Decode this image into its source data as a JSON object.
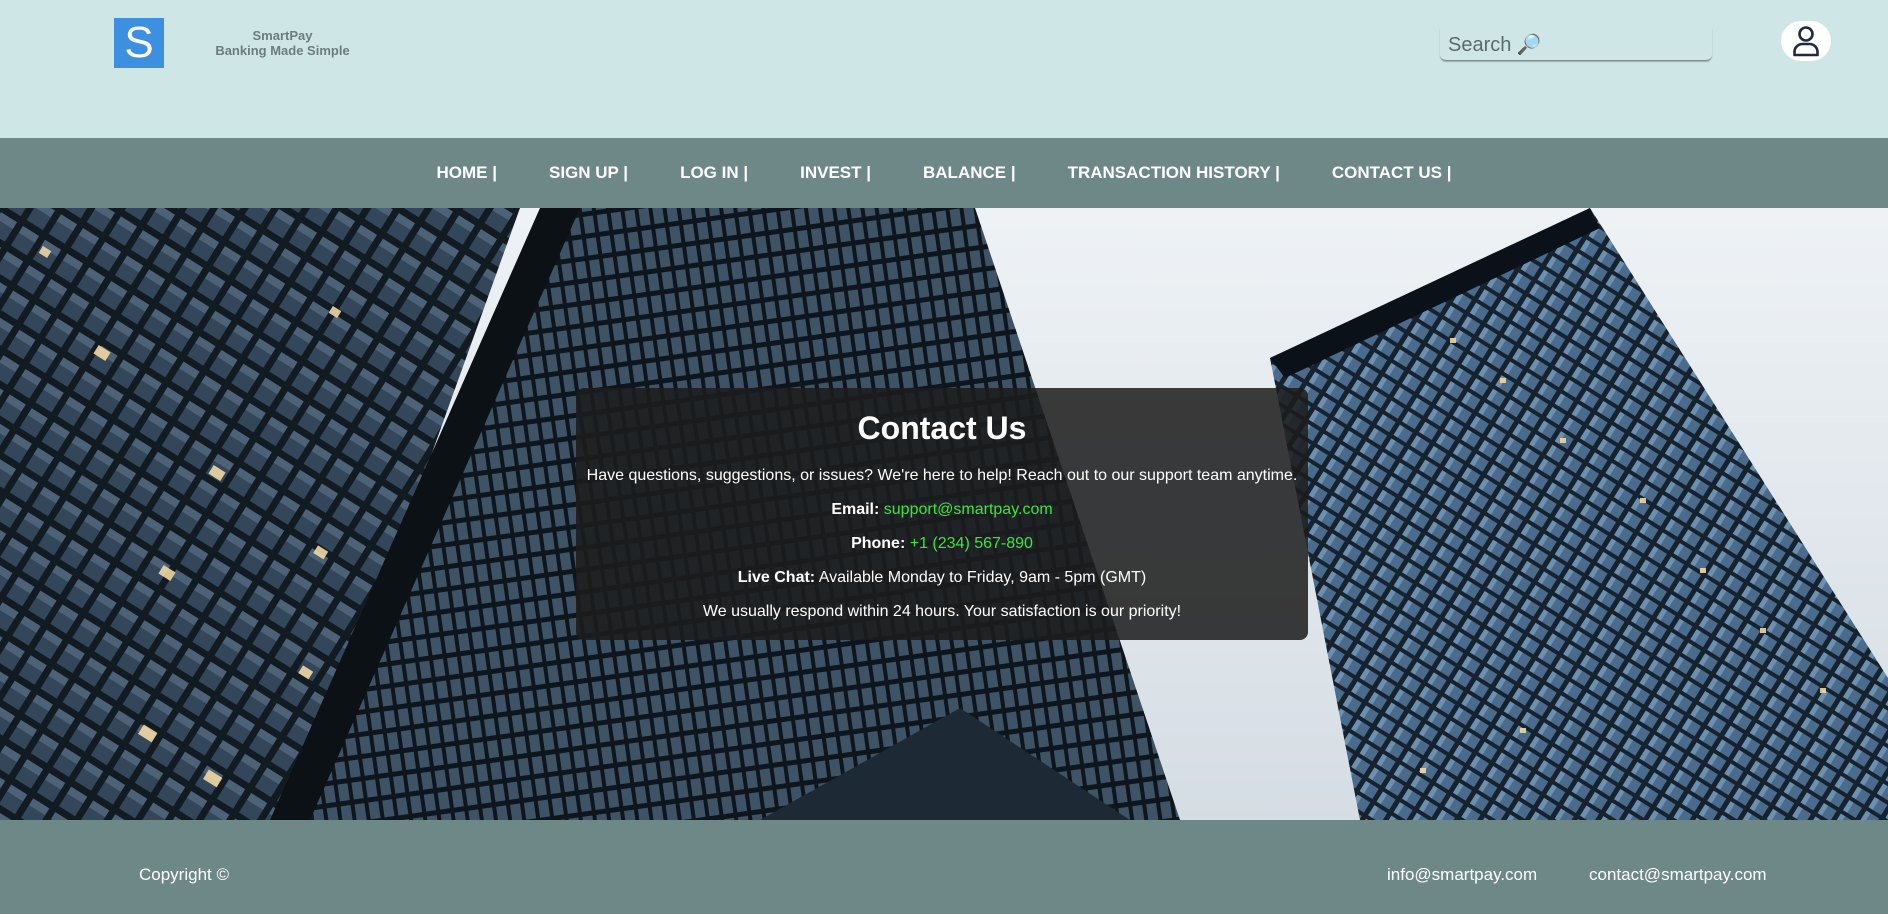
{
  "brand": {
    "logo_letter": "S",
    "name": "SmartPay",
    "tagline": "Banking Made Simple"
  },
  "search": {
    "placeholder": "Search 🔎",
    "value": ""
  },
  "user": {
    "icon": "user-icon"
  },
  "nav": {
    "items": [
      {
        "label": "HOME |"
      },
      {
        "label": "SIGN UP |"
      },
      {
        "label": "LOG IN |"
      },
      {
        "label": "INVEST |"
      },
      {
        "label": "BALANCE |"
      },
      {
        "label": "TRANSACTION HISTORY |"
      },
      {
        "label": "CONTACT US |"
      }
    ]
  },
  "contact": {
    "title": "Contact Us",
    "intro": "Have questions, suggestions, or issues? We're here to help! Reach out to our support team anytime.",
    "email_label": "Email:",
    "email": "support@smartpay.com",
    "phone_label": "Phone:",
    "phone": "+1 (234) 567-890",
    "chat_label": "Live Chat:",
    "chat": "Available Monday to Friday, 9am - 5pm (GMT)",
    "note": "We usually respond within 24 hours. Your satisfaction is our priority!"
  },
  "footer": {
    "copyright": "Copyright ©",
    "email_1": "info@smartpay.com",
    "email_2": "contact@smartpay.com"
  },
  "colors": {
    "header_bg": "#cfe6e7",
    "nav_bg": "#6e8887",
    "logo_bg": "#3d8fe0",
    "link_green": "#39e83a"
  }
}
